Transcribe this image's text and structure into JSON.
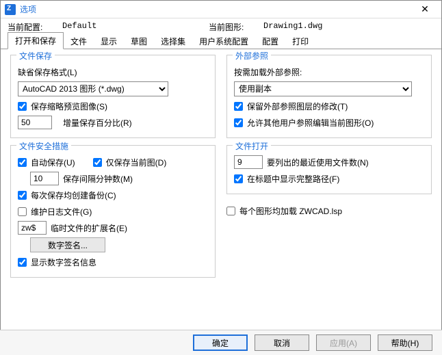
{
  "window": {
    "title": "选项"
  },
  "info": {
    "profile_label": "当前配置:",
    "profile_value": "Default",
    "drawing_label": "当前图形:",
    "drawing_value": "Drawing1.dwg"
  },
  "tabs": [
    "打开和保存",
    "文件",
    "显示",
    "草图",
    "选择集",
    "用户系统配置",
    "配置",
    "打印"
  ],
  "filesave": {
    "legend": "文件保存",
    "format_label": "缺省保存格式(L)",
    "format_value": "AutoCAD 2013 图形 (*.dwg)",
    "thumbnail_label": "保存缩略预览图像(S)",
    "increment_value": "50",
    "increment_label": "增量保存百分比(R)"
  },
  "safety": {
    "legend": "文件安全措施",
    "autosave_label": "自动保存(U)",
    "onlycurrent_label": "仅保存当前图(D)",
    "interval_value": "10",
    "interval_label": "保存间隔分钟数(M)",
    "backup_label": "每次保存均创建备份(C)",
    "log_label": "维护日志文件(G)",
    "ext_value": "zw$",
    "ext_label": "临时文件的扩展名(E)",
    "digisign_button": "数字签名...",
    "showsign_label": "显示数字签名信息"
  },
  "xref": {
    "legend": "外部参照",
    "load_label": "按需加载外部参照:",
    "load_value": "使用副本",
    "retain_label": "保留外部参照图层的修改(T)",
    "allowedit_label": "允许其他用户参照编辑当前图形(O)"
  },
  "fileopen": {
    "legend": "文件打开",
    "recent_value": "9",
    "recent_label": "要列出的最近使用文件数(N)",
    "fullpath_label": "在标题中显示完整路径(F)"
  },
  "loadlsp_label": "每个图形均加载 ZWCAD.lsp",
  "footer": {
    "ok": "确定",
    "cancel": "取消",
    "apply": "应用(A)",
    "help": "帮助(H)"
  }
}
